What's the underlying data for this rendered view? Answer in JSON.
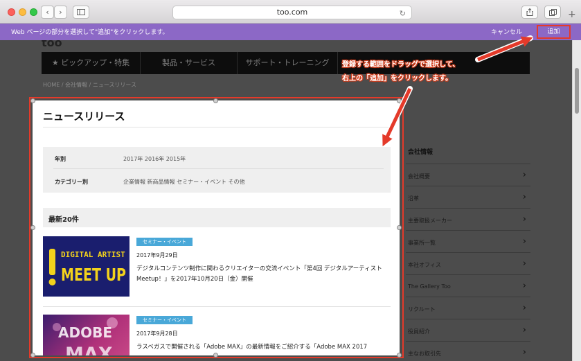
{
  "browser": {
    "url": "too.com",
    "icons": [
      "back-icon",
      "forward-icon",
      "sidebar-icon",
      "reload-icon",
      "share-icon",
      "tabs-icon",
      "new-tab-icon"
    ]
  },
  "clip_bar": {
    "message": "Web ページの部分を選択して\"追加\"をクリックします。",
    "cancel_label": "キャンセル",
    "add_label": "追加",
    "color": "#8c68c6"
  },
  "site": {
    "logo": "too",
    "nav": [
      "★  ピックアップ・特集",
      "製品・サービス",
      "サポート・トレーニング"
    ],
    "breadcrumb": "HOME  /  会社情報  /  ニュースリリース",
    "sidebar": {
      "title": "会社情報",
      "items": [
        "会社概要",
        "沿革",
        "主要取扱メーカー",
        "事業所一覧",
        "本社オフィス",
        "The Gallery Too",
        "リクルート",
        "役員紹介",
        "主なお取引先"
      ]
    }
  },
  "selection": {
    "page_title": "ニュースリリース",
    "filters": {
      "year_label": "年別",
      "years": "2017年    2016年    2015年",
      "category_label": "カテゴリー別",
      "categories": "企業情報    新商品情報    セミナー・イベント    その他"
    },
    "latest_label": "最新20件",
    "items": [
      {
        "badge": "セミナー・イベント",
        "date": "2017年9月29日",
        "title": "デジタルコンテンツ制作に関わるクリエイターの交流イベント「第4回 デジタルアーティスト Meetup！」を2017年10月20日（金）開催",
        "image_text_line1": "DIGITAL ARTIST",
        "image_text_line2": "MEET UP"
      },
      {
        "badge": "セミナー・イベント",
        "date": "2017年9月28日",
        "title": "ラスベガスで開催される「Adobe MAX」の最新情報をご紹介する「Adobe MAX 2017",
        "image_text_line1": "ADOBE",
        "image_text_line2": "MAX"
      }
    ]
  },
  "annotation": {
    "line1": "登録する範囲をドラッグで選択して、",
    "line2": "右上の「追加」をクリックします。",
    "color": "#e43a2a"
  }
}
